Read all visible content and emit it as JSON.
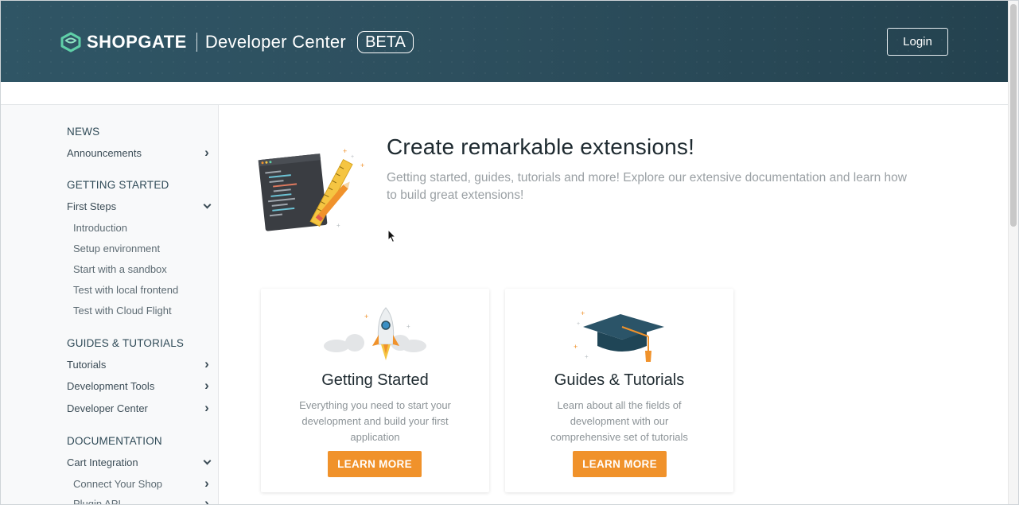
{
  "header": {
    "brand": "SHOPGATE",
    "subtitle": "Developer Center",
    "badge": "BETA",
    "login_label": "Login"
  },
  "sidebar": {
    "sections": [
      {
        "title": "NEWS"
      },
      {
        "title": "GETTING STARTED"
      },
      {
        "title": "GUIDES & TUTORIALS"
      },
      {
        "title": "DOCUMENTATION"
      }
    ],
    "items": {
      "announcements": "Announcements",
      "first_steps": "First Steps",
      "introduction": "Introduction",
      "setup_environment": "Setup environment",
      "start_sandbox": "Start with a sandbox",
      "test_local_frontend": "Test with local frontend",
      "test_cloud_flight": "Test with Cloud Flight",
      "tutorials": "Tutorials",
      "development_tools": "Development Tools",
      "developer_center": "Developer Center",
      "cart_integration": "Cart Integration",
      "connect_your_shop": "Connect Your Shop",
      "plugin_api": "Plugin API"
    }
  },
  "hero": {
    "title": "Create remarkable extensions!",
    "description": "Getting started, guides, tutorials and more! Explore our extensive documentation and learn how to build great extensions!"
  },
  "cards": [
    {
      "title": "Getting Started",
      "description": "Everything you need to start your development and build your first application",
      "button": "LEARN MORE"
    },
    {
      "title": "Guides & Tutorials",
      "description": "Learn about all the fields of development with our comprehensive set of tutorials",
      "button": "LEARN MORE"
    }
  ],
  "colors": {
    "header_bg": "#2d4f5e",
    "accent": "#f0922b",
    "logo_green": "#5fd0a8"
  }
}
